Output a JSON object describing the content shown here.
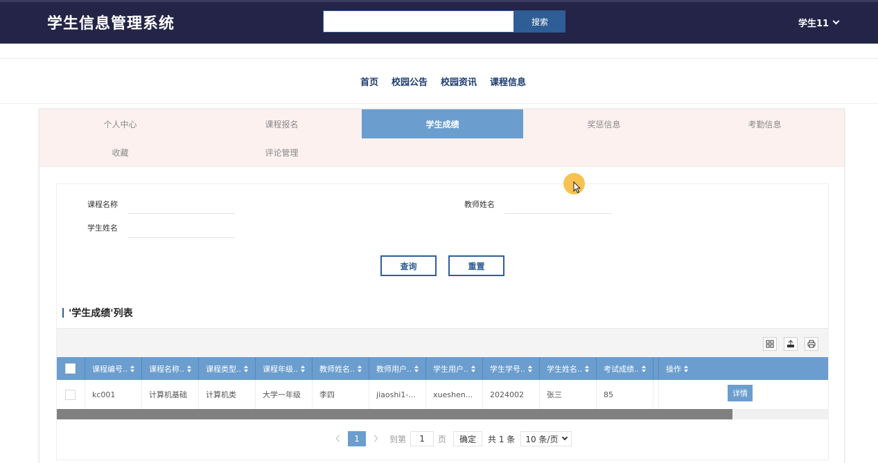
{
  "header": {
    "brand": "学生信息管理系统",
    "search": {
      "placeholder": "",
      "button_label": "搜索"
    },
    "user_label": "学生11"
  },
  "nav": {
    "items": [
      "首页",
      "校园公告",
      "校园资讯",
      "课程信息"
    ]
  },
  "tabs": {
    "items": [
      "个人中心",
      "课程报名",
      "学生成绩",
      "奖惩信息",
      "考勤信息",
      "收藏",
      "评论管理"
    ],
    "active": "学生成绩"
  },
  "filters": {
    "course_name_label": "课程名称",
    "teacher_name_label": "教师姓名",
    "student_name_label": "学生姓名",
    "query_button": "查询",
    "reset_button": "重置"
  },
  "list": {
    "title": "'学生成绩'列表"
  },
  "toolbar": {
    "icons": [
      "columns-icon",
      "export-icon",
      "print-icon"
    ]
  },
  "table": {
    "columns": [
      "课程编号..",
      "课程名称..",
      "课程类型..",
      "课程年级..",
      "教师姓名..",
      "教师用户..",
      "学生用户..",
      "学生学号..",
      "学生姓名..",
      "考试成绩..",
      "操作"
    ],
    "rows": [
      {
        "cells": [
          "kc001",
          "计算机基础",
          "计算机类",
          "大学一年级",
          "李四",
          "jiaoshi1-...",
          "xueshen...",
          "2024002",
          "张三",
          "85"
        ],
        "action": "详情"
      }
    ]
  },
  "pagination": {
    "current_page": "1",
    "goto_label": "到第",
    "goto_value": "1",
    "page_unit": "页",
    "confirm": "确定",
    "total": "共 1 条",
    "page_size": "10 条/页"
  },
  "colors": {
    "header_bg": "#232448",
    "accent": "#6b9dce",
    "primary": "#2f5d95",
    "tabs_bg": "#fdf1f0"
  }
}
